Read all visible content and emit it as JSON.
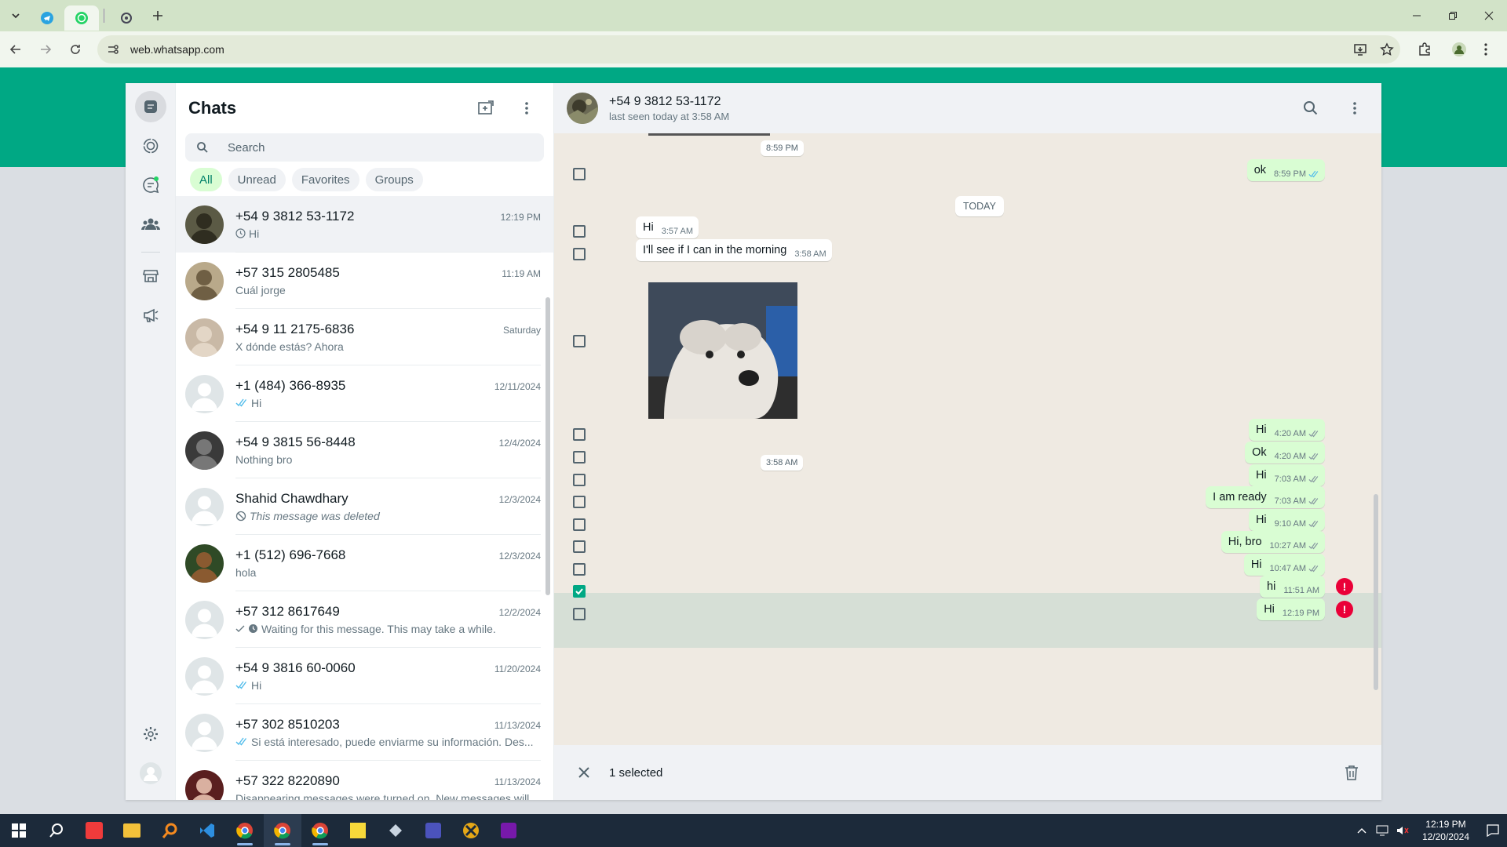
{
  "browser": {
    "url": "web.whatsapp.com"
  },
  "sidebar": {
    "title": "Chats",
    "search_placeholder": "Search",
    "filters": [
      "All",
      "Unread",
      "Favorites",
      "Groups"
    ],
    "chats": [
      {
        "name": "+54 9 3812 53-1172",
        "time": "12:19 PM",
        "preview": "Hi",
        "status": "clock"
      },
      {
        "name": "+57 315 2805485",
        "time": "11:19 AM",
        "preview": "Cuál jorge",
        "status": ""
      },
      {
        "name": "+54 9 11 2175-6836",
        "time": "Saturday",
        "preview": "X dónde estás? Ahora",
        "status": ""
      },
      {
        "name": "+1 (484) 366-8935",
        "time": "12/11/2024",
        "preview": "Hi",
        "status": "read"
      },
      {
        "name": "+54 9 3815 56-8448",
        "time": "12/4/2024",
        "preview": "Nothing bro",
        "status": ""
      },
      {
        "name": "Shahid Chawdhary",
        "time": "12/3/2024",
        "preview": "This message was deleted",
        "status": "deleted"
      },
      {
        "name": "+1 (512) 696-7668",
        "time": "12/3/2024",
        "preview": "hola",
        "status": ""
      },
      {
        "name": "+57 312 8617649",
        "time": "12/2/2024",
        "preview": "Waiting for this message. This may take a while.",
        "status": "waiting"
      },
      {
        "name": "+54 9 3816 60-0060",
        "time": "11/20/2024",
        "preview": "Hi",
        "status": "read"
      },
      {
        "name": "+57 302 8510203",
        "time": "11/13/2024",
        "preview": "Si está interesado, puede enviarme su información. Des...",
        "status": "read"
      },
      {
        "name": "+57 322 8220890",
        "time": "11/13/2024",
        "preview": "Disappearing messages were turned on. New messages will...",
        "status": ""
      }
    ]
  },
  "conversation": {
    "name": "+54 9 3812 53-1172",
    "status": "last seen today at 3:58 AM",
    "top_stamp": "8:59 PM",
    "day_label": "TODAY",
    "image_time": "3:58 AM",
    "messages": [
      {
        "text": "ok",
        "time": "8:59 PM",
        "dir": "out",
        "tick": "read"
      },
      {
        "text": "Hi",
        "time": "3:57 AM",
        "dir": "in"
      },
      {
        "text": "I'll see if I can in the morning",
        "time": "3:58 AM",
        "dir": "in"
      },
      {
        "text": "Hi",
        "time": "4:20 AM",
        "dir": "out",
        "tick": "read"
      },
      {
        "text": "Ok",
        "time": "4:20 AM",
        "dir": "out",
        "tick": "read"
      },
      {
        "text": "Hi",
        "time": "7:03 AM",
        "dir": "out",
        "tick": "read"
      },
      {
        "text": "I am ready",
        "time": "7:03 AM",
        "dir": "out",
        "tick": "read"
      },
      {
        "text": "Hi",
        "time": "9:10 AM",
        "dir": "out",
        "tick": "read"
      },
      {
        "text": "Hi, bro",
        "time": "10:27 AM",
        "dir": "out",
        "tick": "read"
      },
      {
        "text": "Hi",
        "time": "10:47 AM",
        "dir": "out",
        "tick": "read"
      },
      {
        "text": "hi",
        "time": "11:51 AM",
        "dir": "out",
        "tick": "error"
      },
      {
        "text": "Hi",
        "time": "12:19 PM",
        "dir": "out",
        "tick": "error"
      }
    ],
    "selection": "1 selected",
    "error_mark": "!"
  },
  "taskbar": {
    "time": "12:19 PM",
    "date": "12/20/2024"
  },
  "colors": {
    "accent": "#00a884",
    "outgoing": "#d9fdd3",
    "error": "#ea0038"
  }
}
